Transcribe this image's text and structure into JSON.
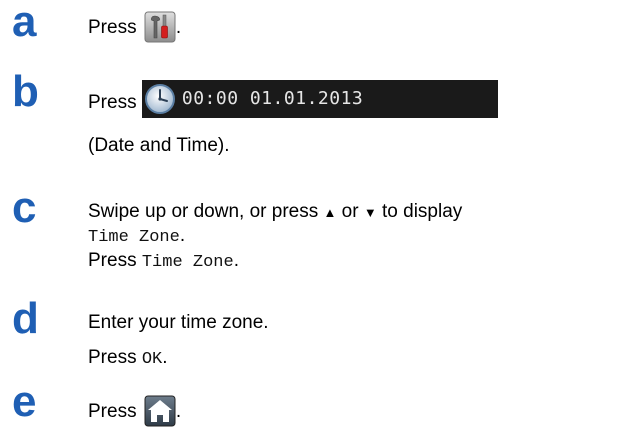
{
  "steps": [
    {
      "letter": "a",
      "press": "Press",
      "tail": "."
    },
    {
      "letter": "b",
      "press": "Press",
      "datetime": "00:00 01.01.2013",
      "caption": "(Date and Time)."
    },
    {
      "letter": "c",
      "line1_a": "Swipe up or down, or press",
      "up_arrow": "▲",
      "or": "or",
      "down_arrow": "▼",
      "line1_b": "to display",
      "menu_item": "Time Zone",
      "period": ".",
      "press": "Press"
    },
    {
      "letter": "d",
      "line1": "Enter your time zone.",
      "press": "Press",
      "ok": "OK",
      "period": "."
    },
    {
      "letter": "e",
      "press": "Press",
      "tail": "."
    }
  ],
  "icons": {
    "settings": "settings-tools-icon",
    "clock": "clock-icon",
    "home": "home-icon"
  },
  "colors": {
    "step_letter": "#1f5fb4",
    "datetime_bar_bg": "#1a1a1a",
    "datetime_text": "#e6e6e6"
  }
}
